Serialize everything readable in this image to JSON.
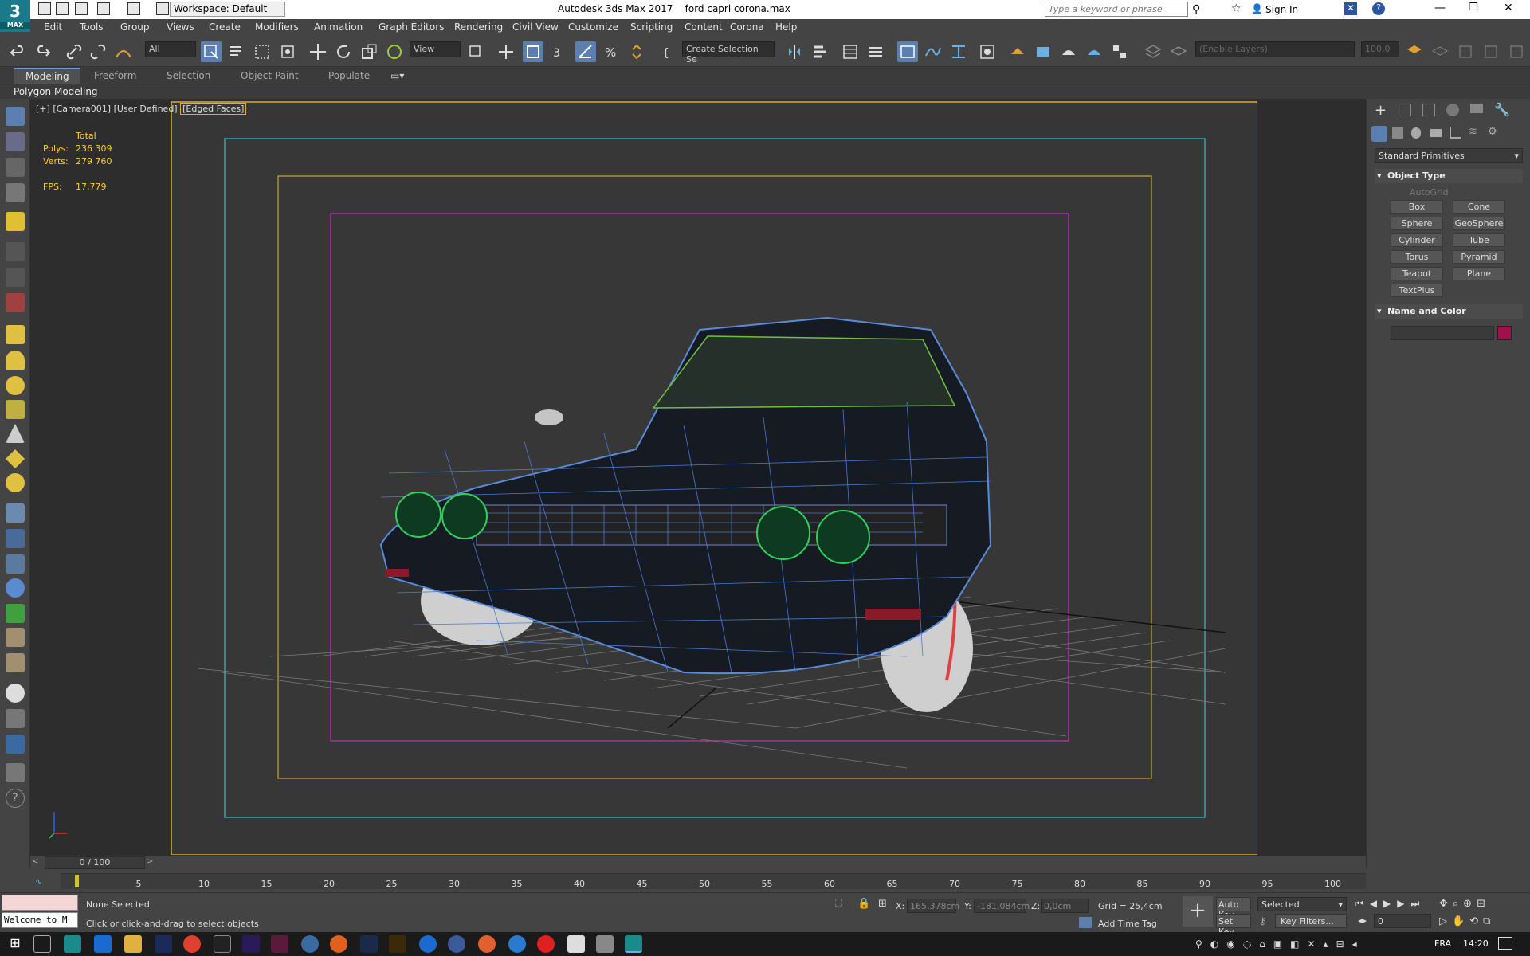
{
  "app": {
    "title": "Autodesk 3ds Max 2017",
    "filename": "ford capri corona.max",
    "logo": "3",
    "logo_sub": "MAX",
    "workspace": "Workspace: Default",
    "search_placeholder": "Type a keyword or phrase",
    "signin": "Sign In"
  },
  "menu": [
    "Edit",
    "Tools",
    "Group",
    "Views",
    "Create",
    "Modifiers",
    "Animation",
    "Graph Editors",
    "Rendering",
    "Civil View",
    "Customize",
    "Scripting",
    "Content",
    "Corona",
    "Help"
  ],
  "toolbar": {
    "filter": "All",
    "view": "View",
    "selection_set": "Create Selection Se",
    "layers": "(Enable Layers)",
    "layer_value": "100,0"
  },
  "ribbon": {
    "tabs": [
      "Modeling",
      "Freeform",
      "Selection",
      "Object Paint",
      "Populate"
    ],
    "active": "Modeling",
    "sub": "Polygon Modeling"
  },
  "viewport": {
    "label_plus": "[+]",
    "label_camera": "[Camera001]",
    "label_user": "[User Defined]",
    "label_mode": "[Edged Faces]",
    "stats_total": "Total",
    "polys_label": "Polys:",
    "polys_value": "236 309",
    "verts_label": "Verts:",
    "verts_value": "279 760",
    "fps_label": "FPS:",
    "fps_value": "17,779"
  },
  "command_panel": {
    "category": "Standard Primitives",
    "object_type": "Object Type",
    "autogrid": "AutoGrid",
    "buttons": [
      "Box",
      "Cone",
      "Sphere",
      "GeoSphere",
      "Cylinder",
      "Tube",
      "Torus",
      "Pyramid",
      "Teapot",
      "Plane",
      "TextPlus"
    ],
    "name_color": "Name and Color",
    "color": "#a0104a"
  },
  "timeline": {
    "frame": "0 / 100",
    "ticks": [
      "5",
      "10",
      "15",
      "20",
      "25",
      "30",
      "35",
      "40",
      "45",
      "50",
      "55",
      "60",
      "65",
      "70",
      "75",
      "80",
      "85",
      "90",
      "95",
      "100"
    ]
  },
  "status": {
    "maxscript": "Welcome to M",
    "selection": "None Selected",
    "prompt": "Click or click-and-drag to select objects",
    "x_label": "X:",
    "x_value": "165,378cm",
    "y_label": "Y:",
    "y_value": "-181,084cm",
    "z_label": "Z:",
    "z_value": "0,0cm",
    "grid": "Grid = 25,4cm",
    "add_time_tag": "Add Time Tag",
    "auto_key": "Auto Key",
    "set_key": "Set Key",
    "selected": "Selected",
    "key_filters": "Key Filters...",
    "frame_value": "0"
  },
  "taskbar": {
    "lang": "FRA",
    "time": "14:20"
  }
}
